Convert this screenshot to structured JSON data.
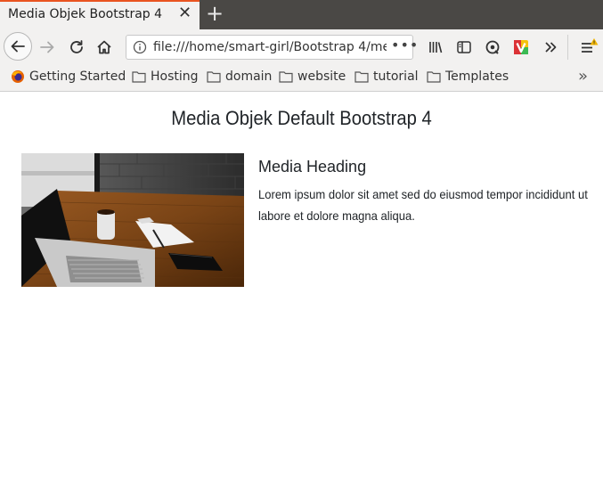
{
  "browser": {
    "tab_title": "Media Objek Bootstrap 4",
    "url": "file:///home/smart-girl/Bootstrap 4/me",
    "url_more": "•••",
    "accent_color": "#e95420"
  },
  "bookmarks": [
    {
      "label": "Getting Started",
      "icon": "firefox-icon"
    },
    {
      "label": "Hosting",
      "icon": "folder-icon"
    },
    {
      "label": "domain",
      "icon": "folder-icon"
    },
    {
      "label": "website",
      "icon": "folder-icon"
    },
    {
      "label": "tutorial",
      "icon": "folder-icon"
    },
    {
      "label": "Templates",
      "icon": "folder-icon"
    }
  ],
  "page": {
    "title": "Media Objek Default Bootstrap 4",
    "media": {
      "heading": "Media Heading",
      "text": "Lorem ipsum dolor sit amet sed do eiusmod tempor incididunt ut labore et dolore magna aliqua."
    }
  }
}
